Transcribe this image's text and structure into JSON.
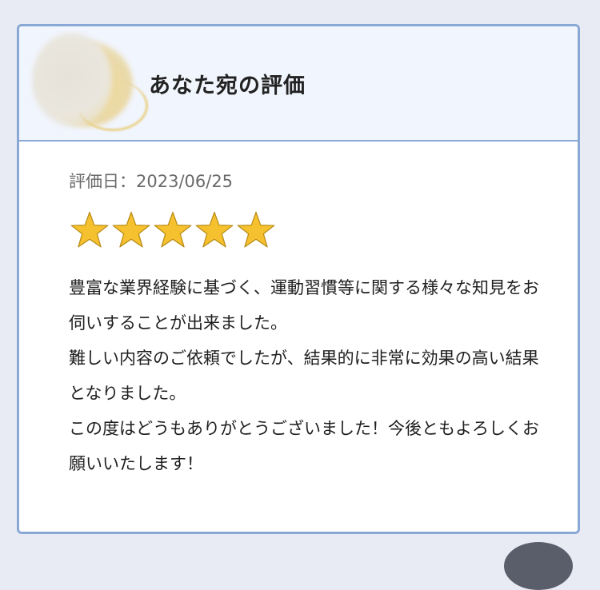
{
  "header": {
    "title": "あなた宛の評価"
  },
  "review": {
    "date_label": "評価日",
    "date_separator": "：",
    "date": "2023/06/25",
    "rating": 5,
    "rating_max": 5,
    "star_color": "#f6c12e",
    "comment": "豊富な業界経験に基づく、運動習慣等に関する様々な知見をお伺いすることが出来ました。\n難しい内容のご依頼でしたが、結果的に非常に効果の高い結果となりました。\nこの度はどうもありがとうございました！今後ともよろしくお願いいたします！"
  },
  "colors": {
    "card_border": "#8aa8d6",
    "header_bg": "#f1f5fd",
    "page_bg": "#e8ebf4"
  }
}
